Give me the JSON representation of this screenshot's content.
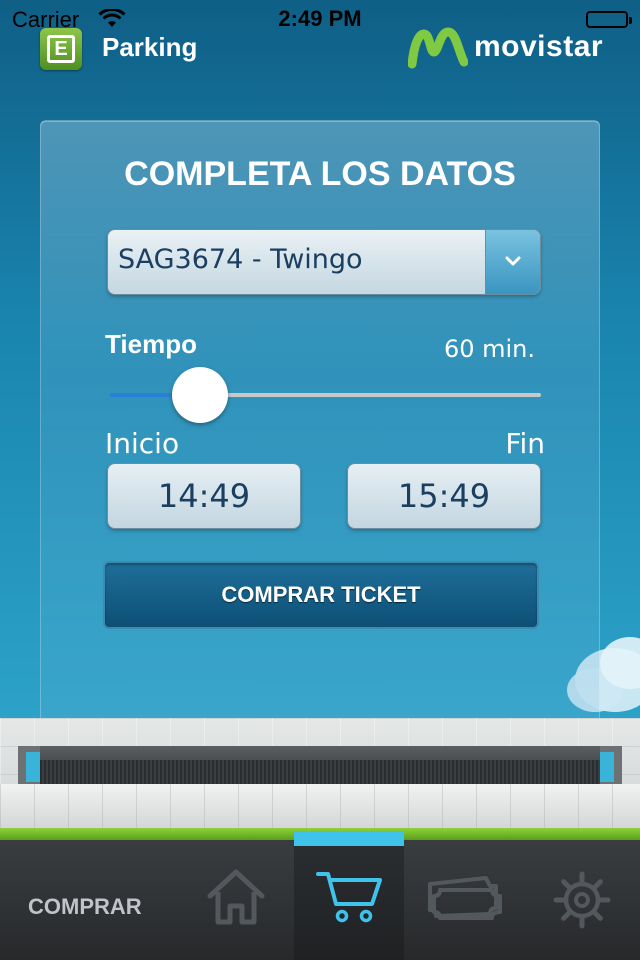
{
  "status_bar": {
    "carrier": "Carrier",
    "time": "2:49 PM"
  },
  "header": {
    "app_icon_letter": "E",
    "app_title": "Parking",
    "brand": "movistar"
  },
  "form": {
    "title": "COMPLETA LOS DATOS",
    "vehicle_selected": "SAG3674 - Twingo",
    "time_label": "Tiempo",
    "time_value": "60 min.",
    "slider_level": 0.21,
    "start_label": "Inicio",
    "end_label": "Fin",
    "start_time": "14:49",
    "end_time": "15:49",
    "buy_button": "COMPRAR TICKET"
  },
  "tab_bar": {
    "current_section": "COMPRAR",
    "tabs": [
      "home-icon",
      "cart-icon",
      "tickets-icon",
      "settings-icon"
    ],
    "active_tab": "cart-icon"
  },
  "colors": {
    "accent_blue": "#3fc3ea",
    "brand_green": "#8fd13a",
    "button_dark": "#0d4f75",
    "text_dark_blue": "#1b3f60"
  }
}
